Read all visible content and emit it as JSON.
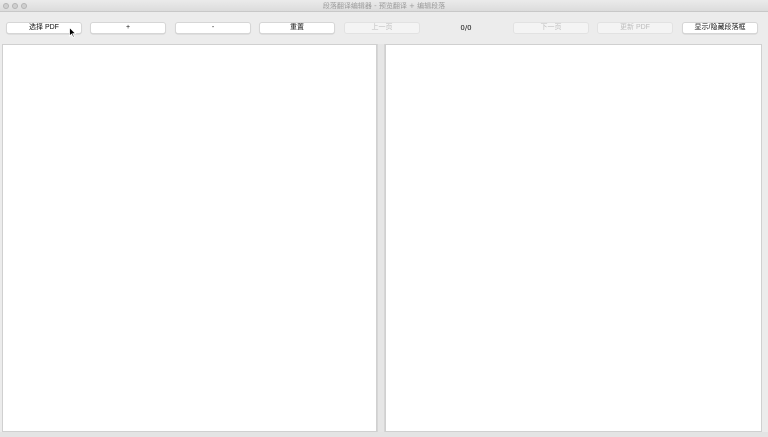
{
  "window": {
    "title": "段落翻译编辑器 - 预览翻译 + 编辑段落"
  },
  "toolbar": {
    "select_pdf_label": "选择 PDF",
    "zoom_in_label": "+",
    "zoom_out_label": "-",
    "reset_label": "重置",
    "prev_page_label": "上一页",
    "page_indicator": "0/0",
    "next_page_label": "下一页",
    "update_pdf_label": "更新 PDF",
    "toggle_boxes_label": "显示/隐藏段落框"
  },
  "icons": {
    "cursor": "mouse-pointer-icon"
  },
  "colors": {
    "window_bg": "#ececec",
    "pane_bg": "#ffffff",
    "disabled_text": "#bdbdbd"
  }
}
